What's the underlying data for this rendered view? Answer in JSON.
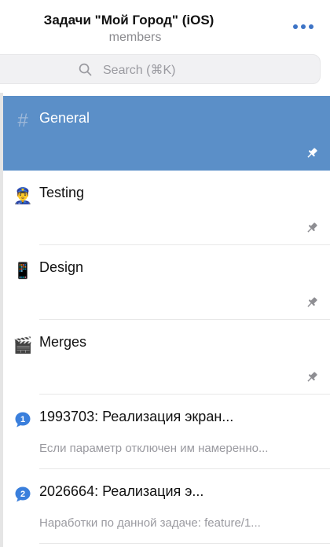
{
  "header": {
    "title": "Задачи \"Мой Город\" (iOS)",
    "subtitle": "members",
    "more_icon": "ellipsis-icon"
  },
  "search": {
    "placeholder": "Search (⌘K)",
    "icon": "search-icon"
  },
  "colors": {
    "accent": "#3d74c6",
    "active_row": "#5b8fc8",
    "muted_text": "#9a9aa0"
  },
  "channels": [
    {
      "name": "General",
      "icon": "#",
      "icon_name": "hash-icon",
      "active": true,
      "pinned": true,
      "preview": ""
    },
    {
      "name": "Testing",
      "icon": "👮‍♂️",
      "icon_name": "police-officer-icon",
      "active": false,
      "pinned": true,
      "preview": ""
    },
    {
      "name": "Design",
      "icon": "📱",
      "icon_name": "mobile-phone-icon",
      "active": false,
      "pinned": true,
      "preview": ""
    },
    {
      "name": "Merges",
      "icon": "🎬",
      "icon_name": "clapper-board-icon",
      "active": false,
      "pinned": true,
      "preview": ""
    },
    {
      "name": "1993703: Реализация экран...",
      "icon": "1",
      "icon_name": "speech-bubble-one-icon",
      "active": false,
      "pinned": false,
      "preview": "Если параметр отключен им намеренно..."
    },
    {
      "name": "2026664: Реализация э...",
      "icon": "2",
      "icon_name": "speech-bubble-two-icon",
      "active": false,
      "pinned": false,
      "preview": "Наработки по данной задаче:  feature/1..."
    }
  ]
}
